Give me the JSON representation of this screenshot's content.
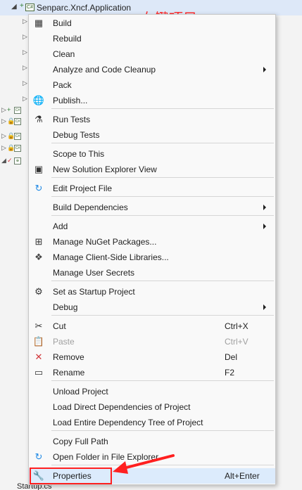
{
  "header": {
    "project_label": "Senparc.Xncf.Application",
    "cs_badge": "C#",
    "plus_sign": "+",
    "expand_glyph": "◢"
  },
  "annotation": {
    "text": "右键项目"
  },
  "footer": {
    "file_label": "Startup.cs"
  },
  "tree_rows": [
    {
      "exp": "▷",
      "mark": "",
      "icon": ""
    },
    {
      "exp": "▷",
      "mark": "",
      "icon": ""
    },
    {
      "exp": "▷",
      "mark": "",
      "icon": ""
    },
    {
      "exp": "▷",
      "mark": "",
      "icon": ""
    },
    {
      "exp": "▷",
      "mark": "",
      "icon": ""
    },
    {
      "exp": "▷",
      "mark": "",
      "icon": ""
    },
    {
      "exp": "▷",
      "mark": "+",
      "icon": "C#"
    },
    {
      "exp": "▷",
      "mark": "🔒",
      "icon": "C#"
    },
    {
      "exp": "▷",
      "mark": "🔒",
      "icon": "C#"
    },
    {
      "exp": "▷",
      "mark": "🔒",
      "icon": "C#"
    },
    {
      "exp": "◢",
      "mark": "✓",
      "icon": "⊕"
    }
  ],
  "menu": {
    "items": [
      {
        "name": "build",
        "label": "Build",
        "icon": "build-icon",
        "glyph": "▦",
        "color": "#333333"
      },
      {
        "name": "rebuild",
        "label": "Rebuild"
      },
      {
        "name": "clean",
        "label": "Clean"
      },
      {
        "name": "analyze",
        "label": "Analyze and Code Cleanup",
        "submenu": true
      },
      {
        "name": "pack",
        "label": "Pack"
      },
      {
        "name": "publish",
        "label": "Publish...",
        "icon": "globe-icon",
        "glyph": "🌐",
        "color": "#1e88e5"
      },
      {
        "name": "run-tests",
        "label": "Run Tests",
        "icon": "flask-icon",
        "glyph": "⚗",
        "color": "#333333"
      },
      {
        "name": "debug-tests",
        "label": "Debug Tests"
      },
      {
        "name": "scope-to-this",
        "label": "Scope to This"
      },
      {
        "name": "new-solution-explorer-view",
        "label": "New Solution Explorer View",
        "icon": "window-icon",
        "glyph": "▣",
        "color": "#333333"
      },
      {
        "name": "edit-project-file",
        "label": "Edit Project File",
        "icon": "refresh-icon",
        "glyph": "↻",
        "color": "#1e88e5"
      },
      {
        "name": "build-dependencies",
        "label": "Build Dependencies",
        "submenu": true
      },
      {
        "name": "add",
        "label": "Add",
        "submenu": true
      },
      {
        "name": "manage-nuget",
        "label": "Manage NuGet Packages...",
        "icon": "package-icon",
        "glyph": "⊞",
        "color": "#333333"
      },
      {
        "name": "manage-client-libs",
        "label": "Manage Client-Side Libraries...",
        "icon": "library-icon",
        "glyph": "❖",
        "color": "#444444"
      },
      {
        "name": "manage-user-secrets",
        "label": "Manage User Secrets"
      },
      {
        "name": "set-startup",
        "label": "Set as Startup Project",
        "icon": "gear-icon",
        "glyph": "⚙",
        "color": "#333333"
      },
      {
        "name": "debug",
        "label": "Debug",
        "submenu": true
      },
      {
        "name": "cut",
        "label": "Cut",
        "shortcut": "Ctrl+X",
        "icon": "scissors-icon",
        "glyph": "✂",
        "color": "#333333"
      },
      {
        "name": "paste",
        "label": "Paste",
        "shortcut": "Ctrl+V",
        "disabled": true,
        "icon": "clipboard-icon",
        "glyph": "📋",
        "color": "#a0a0a0"
      },
      {
        "name": "remove",
        "label": "Remove",
        "shortcut": "Del",
        "icon": "x-icon",
        "glyph": "✕",
        "color": "#d13438"
      },
      {
        "name": "rename",
        "label": "Rename",
        "shortcut": "F2",
        "icon": "rename-icon",
        "glyph": "▭",
        "color": "#333333"
      },
      {
        "name": "unload-project",
        "label": "Unload Project"
      },
      {
        "name": "load-direct-deps",
        "label": "Load Direct Dependencies of Project"
      },
      {
        "name": "load-entire-tree",
        "label": "Load Entire Dependency Tree of Project"
      },
      {
        "name": "copy-full-path",
        "label": "Copy Full Path"
      },
      {
        "name": "open-folder",
        "label": "Open Folder in File Explorer",
        "icon": "open-folder-icon",
        "glyph": "↻",
        "color": "#1e88e5"
      },
      {
        "name": "properties",
        "label": "Properties",
        "shortcut": "Alt+Enter",
        "icon": "wrench-icon",
        "glyph": "🔧",
        "color": "#333333",
        "highlighted": true
      }
    ]
  }
}
